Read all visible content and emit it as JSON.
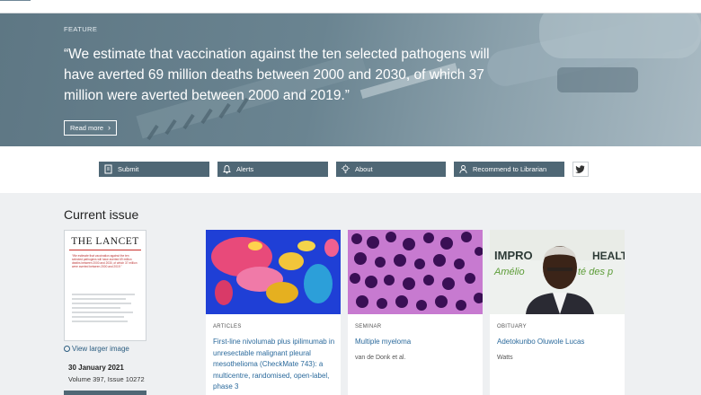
{
  "hero": {
    "kicker": "FEATURE",
    "quote": "“We estimate that vaccination against the ten selected pathogens will have averted 69 million deaths between 2000 and 2030, of which 37 million were averted between 2000 and 2019.”",
    "read_more": "Read more"
  },
  "actions": [
    {
      "label": "Submit",
      "icon": "submit-icon"
    },
    {
      "label": "Alerts",
      "icon": "bell-icon"
    },
    {
      "label": "About",
      "icon": "lightbulb-icon"
    },
    {
      "label": "Recommend to Librarian",
      "icon": "person-icon"
    }
  ],
  "twitter_icon": "twitter-icon",
  "current_issue": {
    "heading": "Current issue",
    "cover_brand": "THE LANCET",
    "cover_blurb": "“We estimate that vaccination against the ten selected pathogens will have averted 69 million deaths between 2000 and 2030, of which 37 million were averted between 2000 and 2019.”",
    "view_larger": "View larger image",
    "date": "30 January 2021",
    "volume": "Volume 397, Issue 10272"
  },
  "articles": [
    {
      "type": "ARTICLES",
      "title": "First-line nivolumab plus ipilimumab in unresectable malignant pleural mesothelioma (CheckMate 743): a multicentre, randomised, open-label, phase 3",
      "authors": ""
    },
    {
      "type": "SEMINAR",
      "title": "Multiple myeloma",
      "authors": "van de Donk et al."
    },
    {
      "type": "OBITUARY",
      "title": "Adetokunbo Oluwole Lucas",
      "authors": "Watts",
      "photo_text_1": "IMPRO",
      "photo_text_2": "HEALT",
      "photo_text_3": "Amélio",
      "photo_text_4": "té des p"
    }
  ],
  "colors": {
    "hero": "#6a8491",
    "button": "#4f6775",
    "link": "#2b6a9c",
    "cover_accent": "#c9302c"
  }
}
